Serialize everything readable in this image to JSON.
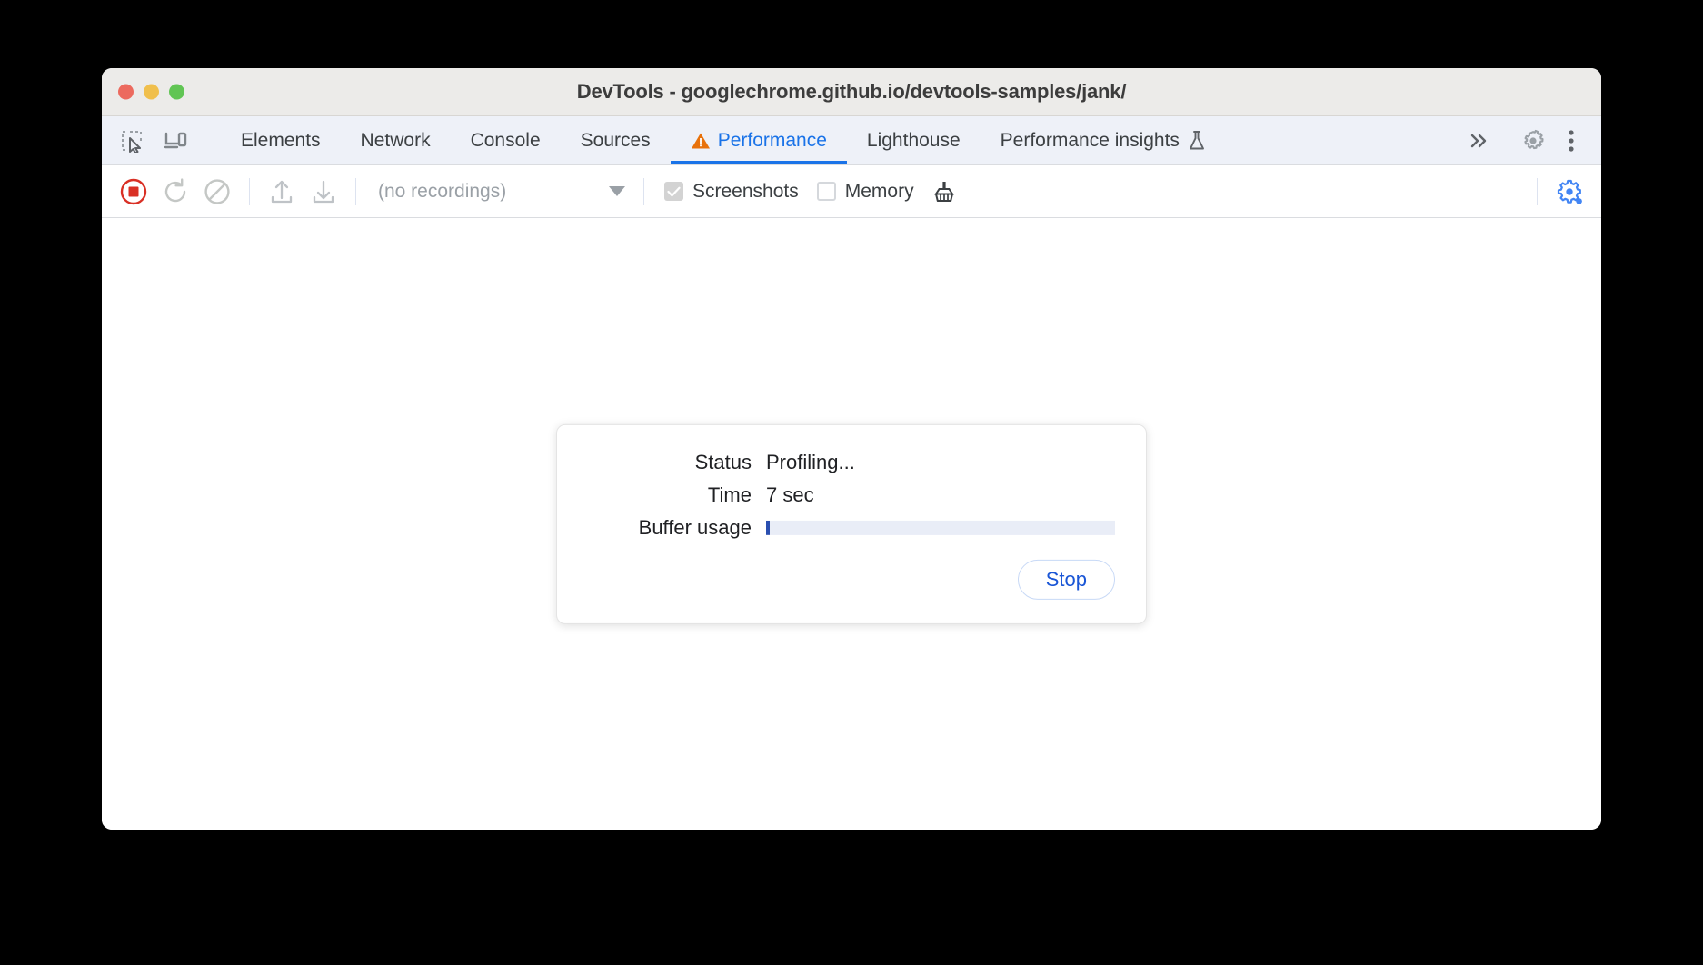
{
  "window": {
    "title": "DevTools - googlechrome.github.io/devtools-samples/jank/",
    "traffic_lights": [
      {
        "name": "close",
        "color": "#ec6a5e"
      },
      {
        "name": "minimize",
        "color": "#f0bf4c"
      },
      {
        "name": "maximize",
        "color": "#61c554"
      }
    ]
  },
  "tabbar": {
    "left_icons": [
      {
        "name": "inspect-element-icon",
        "label": "Inspect element"
      },
      {
        "name": "device-toolbar-icon",
        "label": "Toggle device toolbar"
      }
    ],
    "tabs": [
      {
        "label": "Elements",
        "active": false,
        "warning": false
      },
      {
        "label": "Network",
        "active": false,
        "warning": false
      },
      {
        "label": "Console",
        "active": false,
        "warning": false
      },
      {
        "label": "Sources",
        "active": false,
        "warning": false
      },
      {
        "label": "Performance",
        "active": true,
        "warning": true
      },
      {
        "label": "Lighthouse",
        "active": false,
        "warning": false
      },
      {
        "label": "Performance insights",
        "active": false,
        "warning": false,
        "experiment": true
      }
    ],
    "right_icons": [
      {
        "name": "more-tabs-icon",
        "label": "More tabs"
      },
      {
        "name": "settings-gear-icon",
        "label": "Settings"
      },
      {
        "name": "more-options-icon",
        "label": "Customize and control DevTools"
      }
    ],
    "active_tab_color": "#1a73e8",
    "warning_color": "#e8710a"
  },
  "toolbar": {
    "buttons": [
      {
        "name": "record-button",
        "label": "Stop recording",
        "state": "recording"
      },
      {
        "name": "reload-record-button",
        "label": "Record and reload",
        "state": "disabled"
      },
      {
        "name": "clear-button",
        "label": "Clear",
        "state": "disabled"
      },
      {
        "name": "load-profile-button",
        "label": "Load profile",
        "state": "disabled"
      },
      {
        "name": "save-profile-button",
        "label": "Save profile",
        "state": "disabled"
      }
    ],
    "recordings_select": {
      "value": "(no recordings)",
      "options": [
        "(no recordings)"
      ]
    },
    "checkboxes": [
      {
        "name": "screenshots-checkbox",
        "label": "Screenshots",
        "checked": true,
        "disabled": true
      },
      {
        "name": "memory-checkbox",
        "label": "Memory",
        "checked": false,
        "disabled": false
      }
    ],
    "garbage_collect": {
      "name": "collect-garbage-icon",
      "label": "Collect garbage"
    },
    "capture_settings": {
      "name": "capture-settings-gear-icon",
      "label": "Capture settings",
      "active": true,
      "color": "#4285f4"
    }
  },
  "status_dialog": {
    "rows": [
      {
        "label": "Status",
        "value": "Profiling..."
      },
      {
        "label": "Time",
        "value": "7 sec"
      }
    ],
    "buffer": {
      "label": "Buffer usage",
      "percent": 1,
      "track_color": "#e9edf7",
      "fill_color": "#2a4fb0"
    },
    "stop_button": {
      "label": "Stop"
    }
  }
}
